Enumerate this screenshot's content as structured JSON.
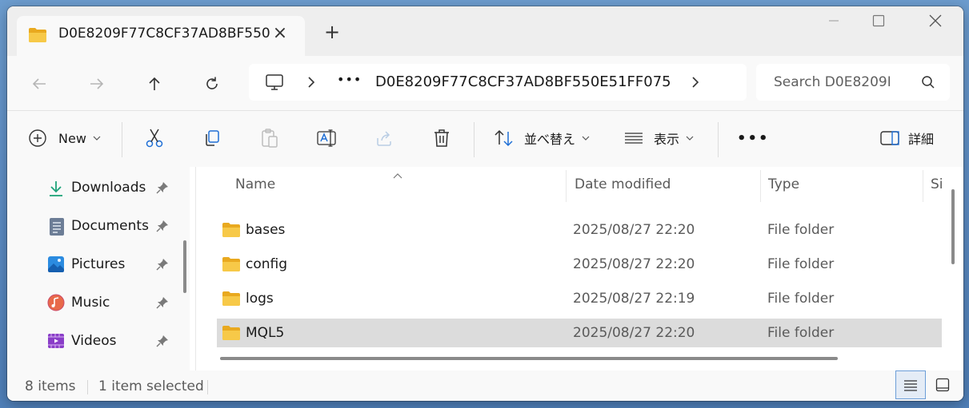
{
  "tab": {
    "title": "D0E8209F77C8CF37AD8BF550",
    "close": "×",
    "new_tab": "+"
  },
  "window_controls": {
    "minimize": "—",
    "maximize": "☐",
    "close": "✕"
  },
  "address": {
    "more": "•••",
    "current": "D0E8209F77C8CF37AD8BF550E51FF075"
  },
  "search": {
    "placeholder": "Search D0E8209I"
  },
  "commands": {
    "new_label": "New",
    "sort_label": "並べ替え",
    "view_label": "表示",
    "more": "•••",
    "details_label": "詳細"
  },
  "sidebar": {
    "items": [
      {
        "label": "Downloads"
      },
      {
        "label": "Documents"
      },
      {
        "label": "Pictures"
      },
      {
        "label": "Music"
      },
      {
        "label": "Videos"
      }
    ]
  },
  "columns": {
    "name": "Name",
    "date": "Date modified",
    "type": "Type",
    "size": "Si"
  },
  "files": [
    {
      "name": "bases",
      "date": "2025/08/27 22:20",
      "type": "File folder"
    },
    {
      "name": "config",
      "date": "2025/08/27 22:20",
      "type": "File folder"
    },
    {
      "name": "logs",
      "date": "2025/08/27 22:19",
      "type": "File folder"
    },
    {
      "name": "MQL5",
      "date": "2025/08/27 22:20",
      "type": "File folder"
    }
  ],
  "status": {
    "count": "8 items",
    "selected": "1 item selected"
  },
  "colors": {
    "folder": "#f7c948",
    "selected_row": "#dcdcdc",
    "accent": "#0067c0"
  }
}
